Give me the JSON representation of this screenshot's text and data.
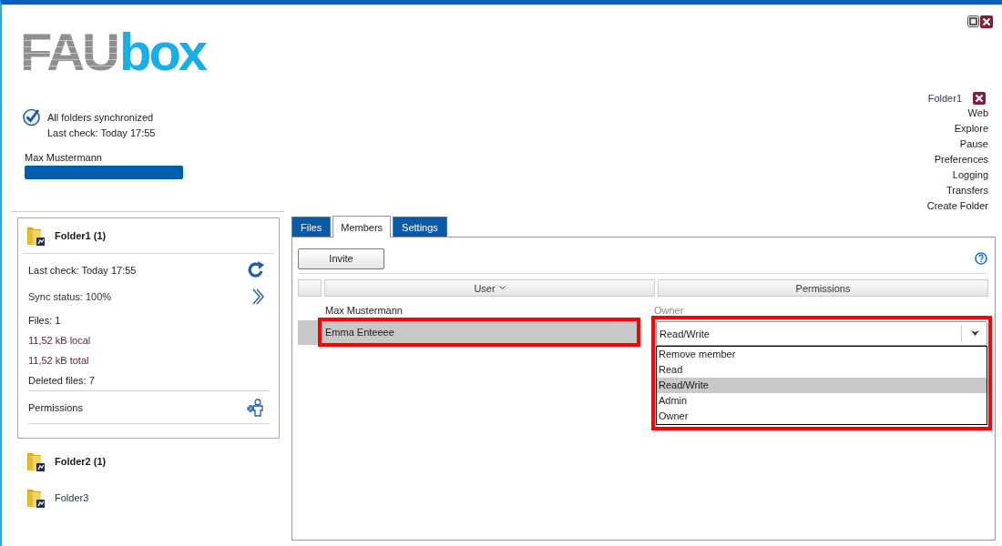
{
  "logo": {
    "part_1": "FAU",
    "part_2": "box"
  },
  "status": {
    "message": "All folders synchronized",
    "last_check": "Last check: Today 17:55",
    "user": "Max Mustermann",
    "quota": {
      "level": 1
    }
  },
  "menu": {
    "folder": "Folder1",
    "items": [
      "Web",
      "Explore",
      "Pause",
      "Preferences",
      "Logging",
      "Transfers",
      "Create Folder"
    ]
  },
  "folders": [
    {
      "name": "Folder1 (1)",
      "has_changes": true,
      "expanded": true,
      "details": {
        "last_check": "Last check: Today 17:55",
        "sync_status": "Sync status: 100%",
        "files": "Files: 1",
        "local": "11,52 kB local",
        "total": "11,52 kB total",
        "deleted": "Deleted files: 7",
        "permissions": "Permissions"
      }
    },
    {
      "name": "Folder2 (1)",
      "has_changes": true,
      "expanded": false
    },
    {
      "name": "Folder3",
      "has_changes": false,
      "expanded": false
    }
  ],
  "tabs": [
    {
      "label": "Files",
      "selected": false
    },
    {
      "label": "Members",
      "selected": true
    },
    {
      "label": "Settings",
      "selected": false
    }
  ],
  "invite_button": "Invite",
  "table": {
    "columns": [
      {
        "label": "User",
        "sorted": true
      },
      {
        "label": "Permissions",
        "sorted": false
      }
    ],
    "rows": [
      {
        "user": "Max Mustermann",
        "permission": "Owner",
        "kind": "text",
        "selected": false,
        "highlighted": false
      },
      {
        "user": "Emma Enteeee",
        "permission": "Read/Write",
        "kind": "dropdown",
        "selected": true,
        "highlighted": true,
        "options": [
          {
            "label": "Remove member",
            "selected": false
          },
          {
            "label": "Read",
            "selected": false
          },
          {
            "label": "Read/Write",
            "selected": true
          },
          {
            "label": "Admin",
            "selected": false
          },
          {
            "label": "Owner",
            "selected": false
          }
        ]
      }
    ]
  }
}
